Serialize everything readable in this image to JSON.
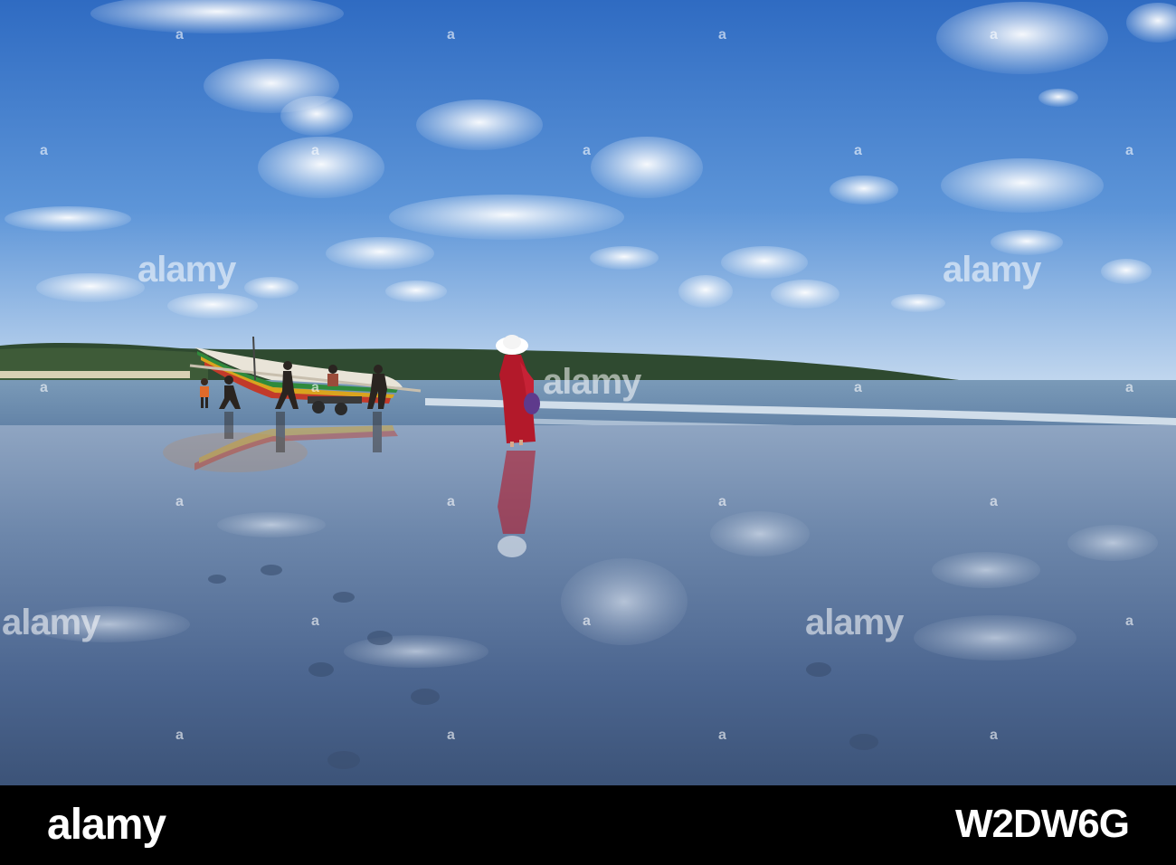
{
  "watermark": {
    "brand": "alamy",
    "small_mark": "a"
  },
  "footer": {
    "logo": "alamy",
    "image_id": "W2DW6G"
  },
  "colors": {
    "sky_top": "#2f6cc4",
    "sky_horizon": "#b9d2ec",
    "sea": "#5d7fa3",
    "wet_sand": "#4f6a90",
    "dress": "#b3192a",
    "footer_bg": "#000000"
  }
}
